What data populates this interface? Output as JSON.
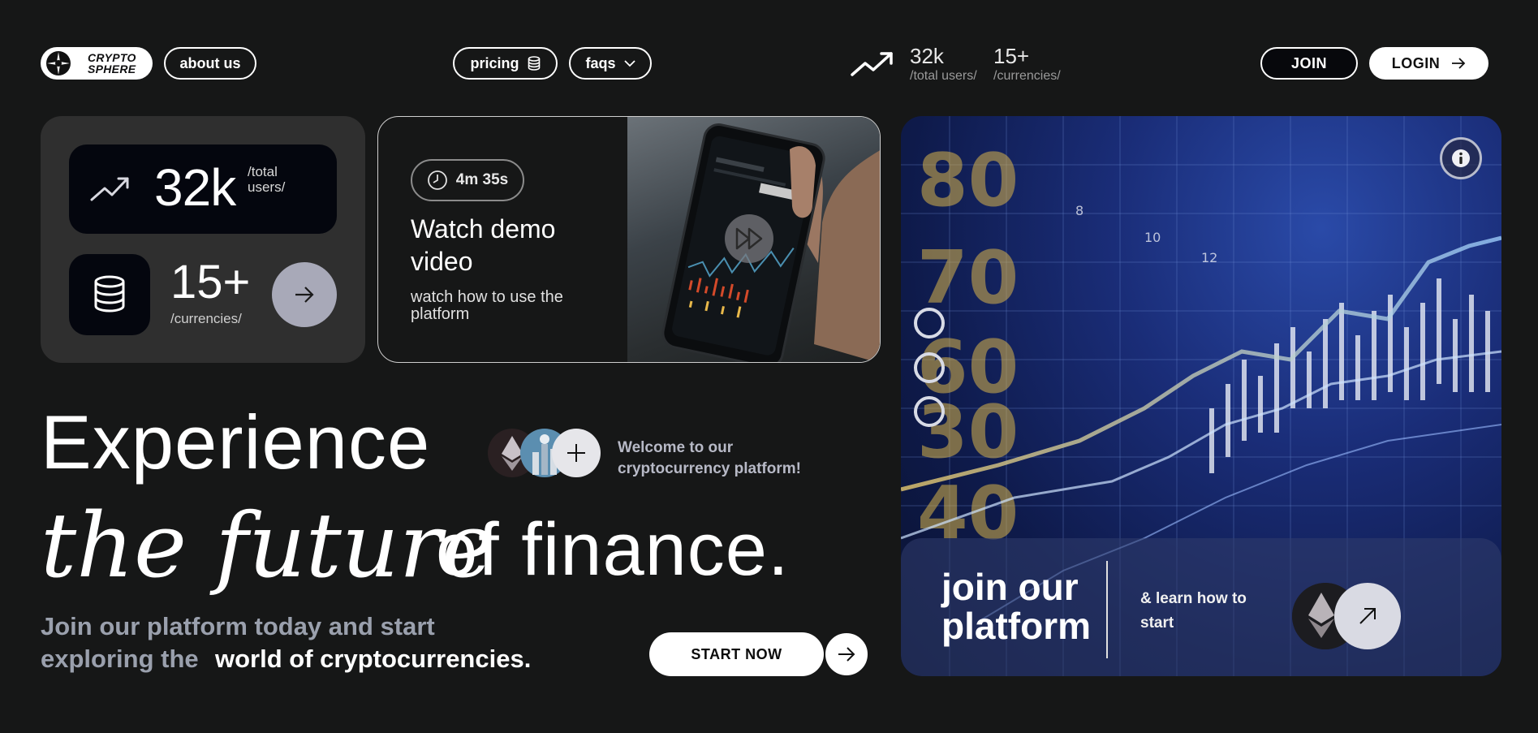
{
  "header": {
    "logo_text_line1": "CRYPTO",
    "logo_text_line2": "SPHERE",
    "nav": {
      "about": "about us",
      "pricing": "pricing",
      "faqs": "faqs"
    },
    "stats": [
      {
        "value": "32k",
        "label": "/total users/"
      },
      {
        "value": "15+",
        "label": "/currencies/"
      }
    ],
    "join_label": "JOIN",
    "login_label": "LOGIN"
  },
  "stats_card": {
    "users_value": "32k",
    "users_label_line1": "/total",
    "users_label_line2": "users/",
    "currencies_value": "15+",
    "currencies_label": "/currencies/"
  },
  "video_card": {
    "duration": "4m 35s",
    "title": "Watch demo video",
    "subtitle": "watch how to use the platform"
  },
  "hero": {
    "line1": "Experience",
    "line2_italic": "the future",
    "line2_rest": "of finance.",
    "welcome": "Welcome to our cryptocurrency platform!",
    "sub_plain": "Join our platform today and start exploring the",
    "sub_emphasis": "world of cryptocurrencies.",
    "start_label": "START NOW"
  },
  "market_card": {
    "join_title": "join our platform",
    "join_sub": "& learn how to start"
  },
  "colors": {
    "background": "#161717",
    "card": "#2f2f2f",
    "dark_box": "#04060e",
    "muted_text": "#9aa0ad",
    "accent_circle": "#a8a9b8"
  },
  "icons": [
    "logo-mark-icon",
    "coins-icon",
    "chevron-down-icon",
    "trend-up-icon",
    "arrow-right-icon",
    "clock-icon",
    "play-forward-icon",
    "plus-icon",
    "ethereum-icon",
    "info-icon",
    "arrow-up-right-icon"
  ]
}
